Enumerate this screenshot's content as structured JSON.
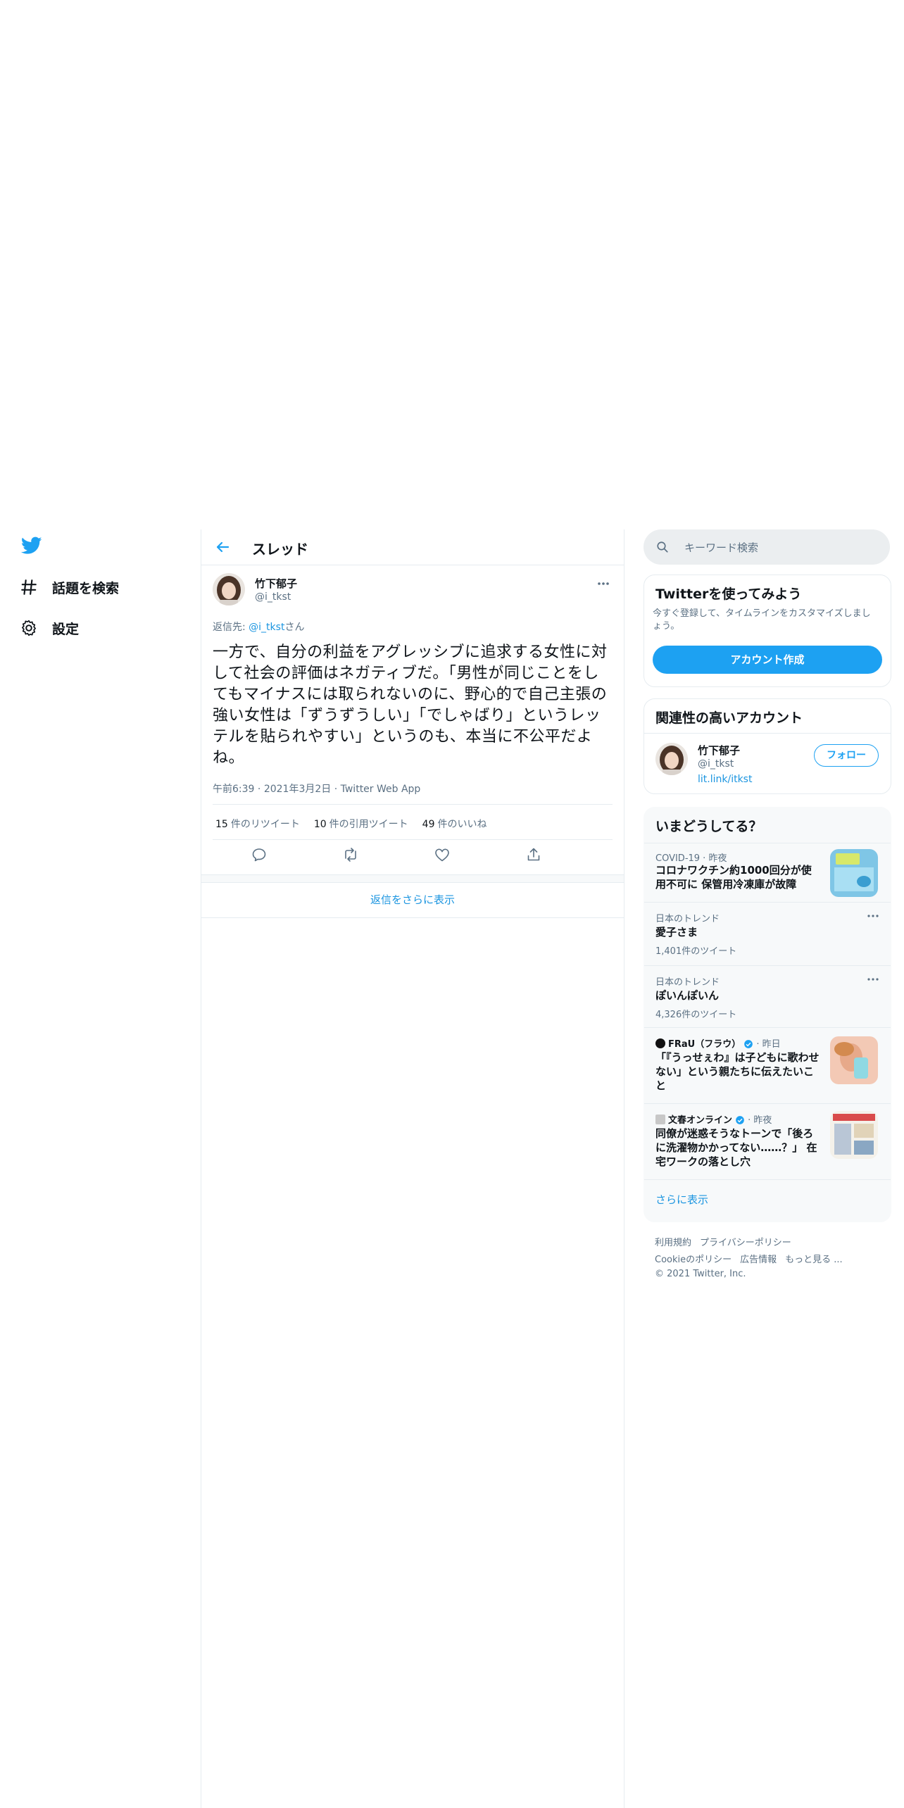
{
  "colors": {
    "accent": "#1da1f2",
    "link": "#1b95e0",
    "secondary_text": "#5b7083",
    "border": "#e6ecf0"
  },
  "nav": {
    "logo_icon": "twitter-bird-icon",
    "items": [
      {
        "icon": "hashtag-icon",
        "label": "話題を検索"
      },
      {
        "icon": "gear-icon",
        "label": "設定"
      }
    ]
  },
  "thread": {
    "title": "スレッド",
    "back_icon": "back-arrow-icon",
    "tweet": {
      "author_name": "竹下郁子",
      "author_handle": "@i_tkst",
      "reply_to_prefix": "返信先: ",
      "reply_to_handle": "@i_tkst",
      "reply_to_suffix": "さん",
      "text": "一方で、自分の利益をアグレッシブに追求する女性に対して社会の評価はネガティブだ。「男性が同じことをしてもマイナスには取られないのに、野心的で自己主張の強い女性は「ずうずうしい」「でしゃばり」というレッテルを貼られやすい」というのも、本当に不公平だよね。",
      "time": "午前6:39",
      "date": "2021年3月2日",
      "source": "Twitter Web App",
      "retweets": "15",
      "retweets_label": "件のリツイート",
      "quotes": "10",
      "quotes_label": "件の引用ツイート",
      "likes": "49",
      "likes_label": "件のいいね",
      "actions": [
        "reply-icon",
        "retweet-icon",
        "like-icon",
        "share-icon"
      ]
    },
    "show_more_replies": "返信をさらに表示"
  },
  "search": {
    "placeholder": "キーワード検索"
  },
  "signup": {
    "title": "Twitterを使ってみよう",
    "description": "今すぐ登録して、タイムラインをカスタマイズしましょう。",
    "button": "アカウント作成"
  },
  "related": {
    "title": "関連性の高いアカウント",
    "name": "竹下郁子",
    "handle": "@i_tkst",
    "link": "lit.link/itkst",
    "follow": "フォロー"
  },
  "trends": {
    "title": "いまどうしてる？",
    "items": [
      {
        "meta": "COVID-19 · 昨夜",
        "title": "コロナワクチン約1000回分が使用不可に 保管用冷凍庫が故障"
      },
      {
        "meta": "日本のトレンド",
        "title": "愛子さま",
        "count": "1,401件のツイート"
      },
      {
        "meta": "日本のトレンド",
        "title": "ぽいんぽいん",
        "count": "4,326件のツイート"
      },
      {
        "source": "FRaU（フラウ）",
        "time": "· 昨日",
        "title": "「『うっせぇわ』は子どもに歌わせない」という親たちに伝えたいこと"
      },
      {
        "source": "文春オンライン",
        "time": "· 昨夜",
        "title": "同僚が迷惑そうなトーンで「後ろに洗濯物かかってない……？」 在宅ワークの落とし穴"
      }
    ],
    "show_more": "さらに表示"
  },
  "footer": {
    "links_row1": [
      "利用規約",
      "プライバシーポリシー"
    ],
    "links_row2": [
      "Cookieのポリシー",
      "広告情報",
      "もっと見る ..."
    ],
    "copyright": "© 2021 Twitter, Inc."
  }
}
